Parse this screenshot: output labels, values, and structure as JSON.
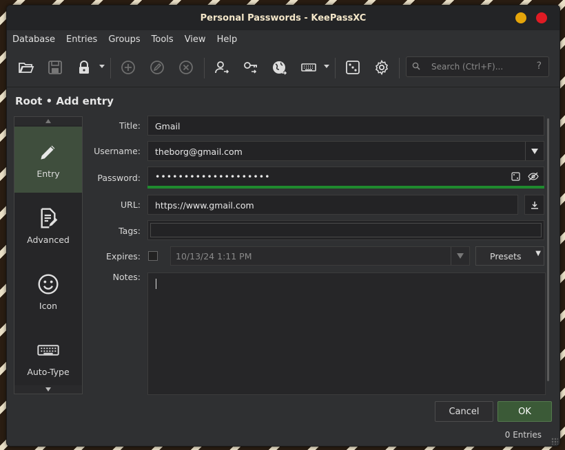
{
  "window": {
    "title": "Personal Passwords - KeePassXC"
  },
  "menu": [
    "Database",
    "Entries",
    "Groups",
    "Tools",
    "View",
    "Help"
  ],
  "search": {
    "placeholder": "Search (Ctrl+F)...",
    "help": "?"
  },
  "heading": "Root • Add entry",
  "categories": [
    {
      "label": "Entry",
      "icon": "pencil-icon"
    },
    {
      "label": "Advanced",
      "icon": "document-edit-icon"
    },
    {
      "label": "Icon",
      "icon": "smiley-icon"
    },
    {
      "label": "Auto-Type",
      "icon": "keyboard-icon"
    }
  ],
  "form": {
    "title_label": "Title:",
    "title_value": "Gmail",
    "username_label": "Username:",
    "username_value": "theborg@gmail.com",
    "password_label": "Password:",
    "password_value": "••••••••••••••••••••",
    "url_label": "URL:",
    "url_value": "https://www.gmail.com",
    "tags_label": "Tags:",
    "tags_value": "",
    "expires_label": "Expires:",
    "expires_value": "10/13/24 1:11 PM",
    "presets_label": "Presets",
    "notes_label": "Notes:",
    "notes_value": ""
  },
  "password_strength_color": "#1f8a2e",
  "buttons": {
    "cancel": "Cancel",
    "ok": "OK"
  },
  "status": "0 Entries",
  "colors": {
    "accent_green": "#3b5a37",
    "minimize": "#e5a50a",
    "close": "#e01b24"
  }
}
